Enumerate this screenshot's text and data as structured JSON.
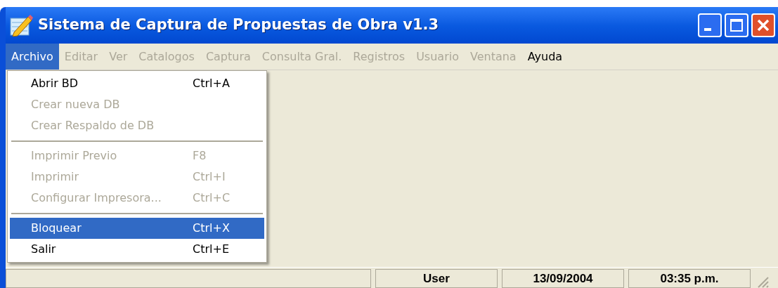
{
  "window": {
    "title": "Sistema de Captura de Propuestas de Obra v1.3"
  },
  "menubar": [
    {
      "label": "Archivo",
      "selected": true,
      "disabled": false
    },
    {
      "label": "Editar",
      "selected": false,
      "disabled": true
    },
    {
      "label": "Ver",
      "selected": false,
      "disabled": true
    },
    {
      "label": "Catalogos",
      "selected": false,
      "disabled": true
    },
    {
      "label": "Captura",
      "selected": false,
      "disabled": true
    },
    {
      "label": "Consulta Gral.",
      "selected": false,
      "disabled": true
    },
    {
      "label": "Registros",
      "selected": false,
      "disabled": true
    },
    {
      "label": "Usuario",
      "selected": false,
      "disabled": true
    },
    {
      "label": "Ventana",
      "selected": false,
      "disabled": true
    },
    {
      "label": "Ayuda",
      "selected": false,
      "disabled": false
    }
  ],
  "menu": [
    {
      "kind": "item",
      "label": "Abrir BD",
      "shortcut": "Ctrl+A",
      "disabled": false,
      "selected": false
    },
    {
      "kind": "item",
      "label": "Crear nueva DB",
      "disabled": true,
      "selected": false
    },
    {
      "kind": "item",
      "label": "Crear Respaldo de DB",
      "disabled": true,
      "selected": false
    },
    {
      "kind": "separator"
    },
    {
      "kind": "item",
      "label": "Imprimir Previo",
      "shortcut": "F8",
      "disabled": true,
      "selected": false
    },
    {
      "kind": "item",
      "label": "Imprimir",
      "shortcut": "Ctrl+I",
      "disabled": true,
      "selected": false
    },
    {
      "kind": "item",
      "label": "Configurar Impresora...",
      "shortcut": "Ctrl+C",
      "disabled": true,
      "selected": false
    },
    {
      "kind": "separator"
    },
    {
      "kind": "item",
      "label": "Bloquear",
      "shortcut": "Ctrl+X",
      "disabled": false,
      "selected": true
    },
    {
      "kind": "item",
      "label": "Salir",
      "shortcut": "Ctrl+E",
      "disabled": false,
      "selected": false
    }
  ],
  "status_bar": [
    "User",
    "13/09/2004",
    "03:35 p.m."
  ]
}
